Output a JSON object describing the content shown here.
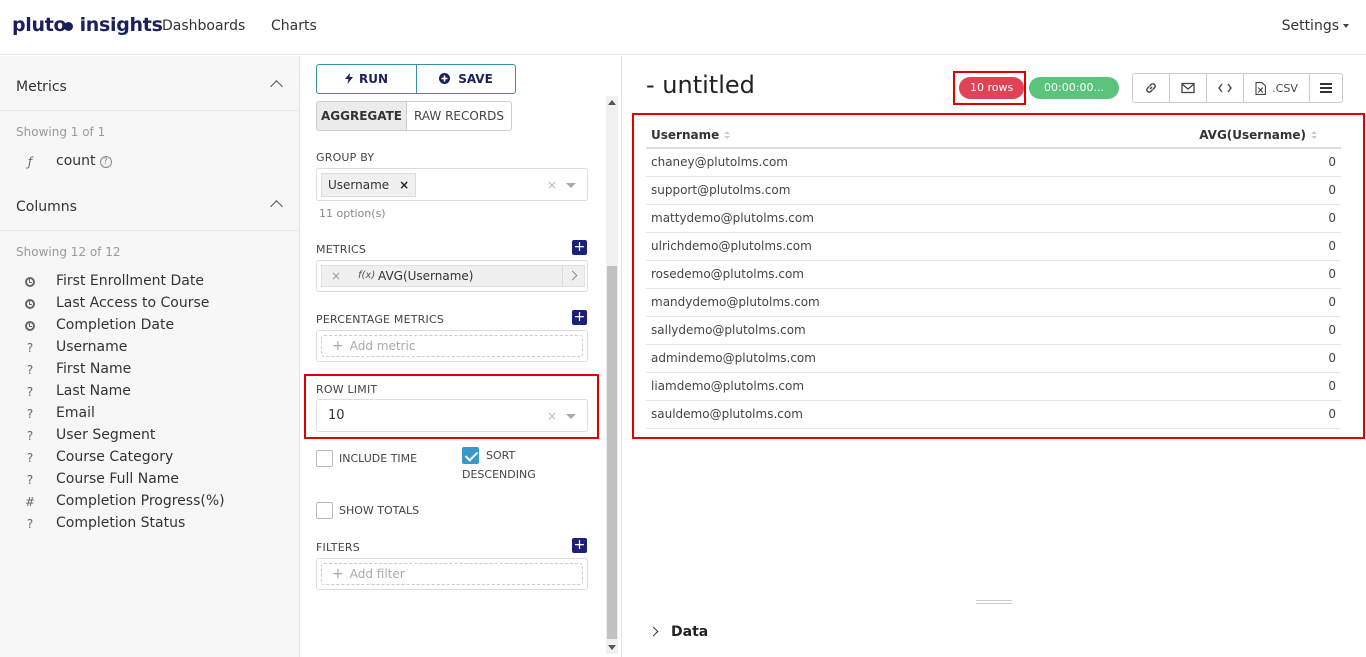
{
  "navbar": {
    "logo": "pluto insights",
    "links": [
      "Dashboards",
      "Charts"
    ],
    "settings": "Settings"
  },
  "metrics": {
    "title": "Metrics",
    "showing": "Showing 1 of 1",
    "items": [
      {
        "icon": "ƒ",
        "label": "count"
      }
    ]
  },
  "columns": {
    "title": "Columns",
    "showing": "Showing 12 of 12",
    "items": [
      {
        "type": "time",
        "label": "First Enrollment Date"
      },
      {
        "type": "time",
        "label": "Last Access to Course"
      },
      {
        "type": "time",
        "label": "Completion Date"
      },
      {
        "type": "?",
        "label": "Username"
      },
      {
        "type": "?",
        "label": "First Name"
      },
      {
        "type": "?",
        "label": "Last Name"
      },
      {
        "type": "?",
        "label": "Email"
      },
      {
        "type": "?",
        "label": "User Segment"
      },
      {
        "type": "?",
        "label": "Course Category"
      },
      {
        "type": "?",
        "label": "Course Full Name"
      },
      {
        "type": "#",
        "label": "Completion Progress(%)"
      },
      {
        "type": "?",
        "label": "Completion Status"
      }
    ]
  },
  "controls": {
    "run_label": "RUN",
    "save_label": "SAVE",
    "aggregate_label": "AGGREGATE",
    "raw_records_label": "RAW RECORDS",
    "group_by_label": "GROUP BY",
    "group_by_value": "Username",
    "group_by_hint": "11 option(s)",
    "metrics_label": "METRICS",
    "metric_fx": "f(x)",
    "metric_value": "AVG(Username)",
    "percentage_metrics_label": "PERCENTAGE METRICS",
    "add_metric_placeholder": "Add metric",
    "row_limit_label": "ROW LIMIT",
    "row_limit_value": "10",
    "include_time_label": "INCLUDE TIME",
    "include_time_checked": false,
    "sort_desc_label_1": "SORT",
    "sort_desc_label_2": "DESCENDING",
    "sort_desc_checked": true,
    "show_totals_label": "SHOW TOTALS",
    "show_totals_checked": false,
    "filters_label": "FILTERS",
    "add_filter_placeholder": "Add filter"
  },
  "result": {
    "title": "- untitled",
    "rows_badge": "10 rows",
    "time_badge": "00:00:00...",
    "csv_label": ".CSV",
    "columns": [
      "Username",
      "AVG(Username)"
    ],
    "rows": [
      [
        "chaney@plutolms.com",
        "0"
      ],
      [
        "support@plutolms.com",
        "0"
      ],
      [
        "mattydemo@plutolms.com",
        "0"
      ],
      [
        "ulrichdemo@plutolms.com",
        "0"
      ],
      [
        "rosedemo@plutolms.com",
        "0"
      ],
      [
        "mandydemo@plutolms.com",
        "0"
      ],
      [
        "sallydemo@plutolms.com",
        "0"
      ],
      [
        "admindemo@plutolms.com",
        "0"
      ],
      [
        "liamdemo@plutolms.com",
        "0"
      ],
      [
        "sauldemo@plutolms.com",
        "0"
      ]
    ],
    "data_section_label": "Data"
  },
  "colors": {
    "brand": "#1b1f5c",
    "rows_badge": "#e04355",
    "time_badge": "#5ac47d",
    "highlight": "#e00000"
  }
}
